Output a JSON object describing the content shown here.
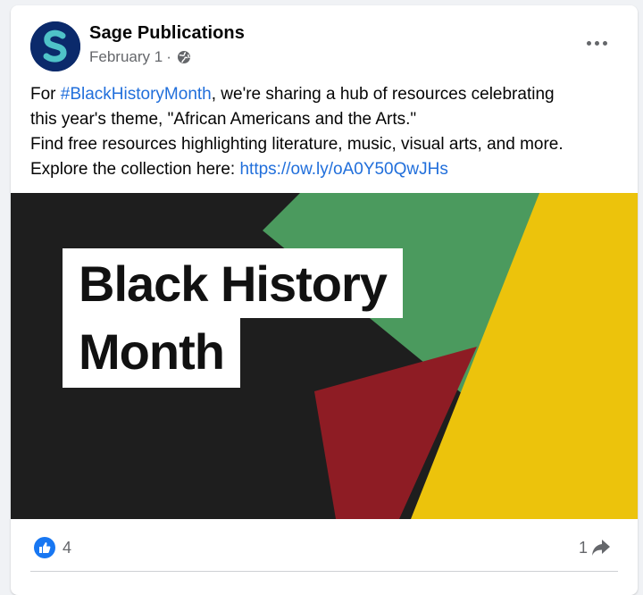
{
  "post": {
    "page_name": "Sage Publications",
    "date": "February 1",
    "separator": "·",
    "privacy_icon": "globe-icon",
    "text": {
      "line1_prefix": "For ",
      "hashtag": "#BlackHistoryMonth",
      "line1_suffix": ", we're sharing a hub of resources celebrating",
      "line2": "this year's theme, \"African Americans and the Arts.\"",
      "line3": "Find free resources highlighting literature, music, visual arts, and more.",
      "line4_prefix": "Explore the collection here: ",
      "link": "https://ow.ly/oA0Y50QwJHs"
    },
    "image": {
      "title_line1": "Black History",
      "title_line2": "Month",
      "colors": {
        "black": "#1e1e1e",
        "green": "#4b9a5e",
        "red": "#8e1c24",
        "yellow": "#ecc30c"
      }
    }
  },
  "footer": {
    "reaction_icon": "like-icon",
    "like_count": "4",
    "share_count": "1",
    "share_icon": "share-icon"
  },
  "colors": {
    "link": "#216fdb",
    "brand": "#1877f2",
    "muted": "#65676b"
  }
}
